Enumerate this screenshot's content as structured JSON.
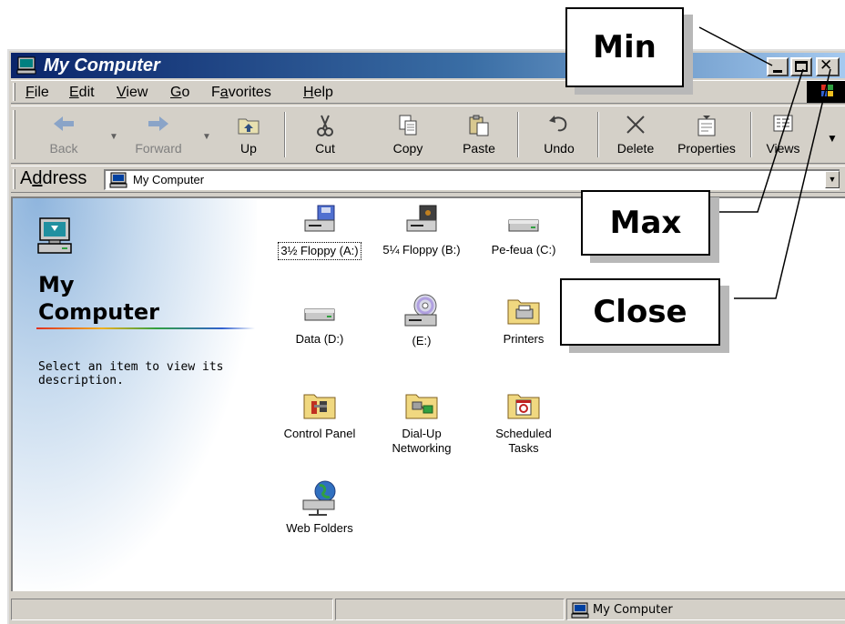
{
  "window": {
    "title": "My Computer"
  },
  "menu": {
    "items": [
      {
        "pre": "",
        "u": "F",
        "post": "ile"
      },
      {
        "pre": "",
        "u": "E",
        "post": "dit"
      },
      {
        "pre": "",
        "u": "V",
        "post": "iew"
      },
      {
        "pre": "",
        "u": "G",
        "post": "o"
      },
      {
        "pre": "F",
        "u": "a",
        "post": "vorites"
      },
      {
        "pre": "",
        "u": "H",
        "post": "elp"
      }
    ]
  },
  "toolbar": {
    "back": "Back",
    "forward": "Forward",
    "up": "Up",
    "cut": "Cut",
    "copy": "Copy",
    "paste": "Paste",
    "undo": "Undo",
    "delete": "Delete",
    "properties": "Properties",
    "views": "Views"
  },
  "address": {
    "label_pre": "A",
    "label_u": "d",
    "label_post": "dress",
    "value": "My Computer"
  },
  "left_pane": {
    "title_line1": "My",
    "title_line2": "Computer",
    "description": "Select an item to view its description."
  },
  "icons": [
    {
      "label": "3½ Floppy (A:)",
      "icon": "floppy-drive-icon",
      "selected": true
    },
    {
      "label": "5¼ Floppy (B:)",
      "icon": "floppy-drive-icon"
    },
    {
      "label": "Pe-feua (C:)",
      "icon": "hard-drive-icon"
    },
    {
      "label": "Data (D:)",
      "icon": "hard-drive-icon"
    },
    {
      "label": "(E:)",
      "icon": "cd-drive-icon"
    },
    {
      "label": "Printers",
      "icon": "printers-folder-icon"
    },
    {
      "label": "Control Panel",
      "icon": "control-panel-folder-icon"
    },
    {
      "label_line1": "Dial-Up",
      "label_line2": "Networking",
      "icon": "dialup-folder-icon"
    },
    {
      "label_line1": "Scheduled",
      "label_line2": "Tasks",
      "icon": "scheduled-tasks-folder-icon"
    },
    {
      "label": "Web Folders",
      "icon": "web-folders-icon"
    }
  ],
  "statusbar": {
    "zone": "My Computer"
  },
  "callouts": {
    "min": "Min",
    "max": "Max",
    "close": "Close"
  },
  "colors": {
    "title_gradient_start": "#0a246a",
    "title_gradient_end": "#a6caf0",
    "chrome": "#d4d0c8"
  }
}
